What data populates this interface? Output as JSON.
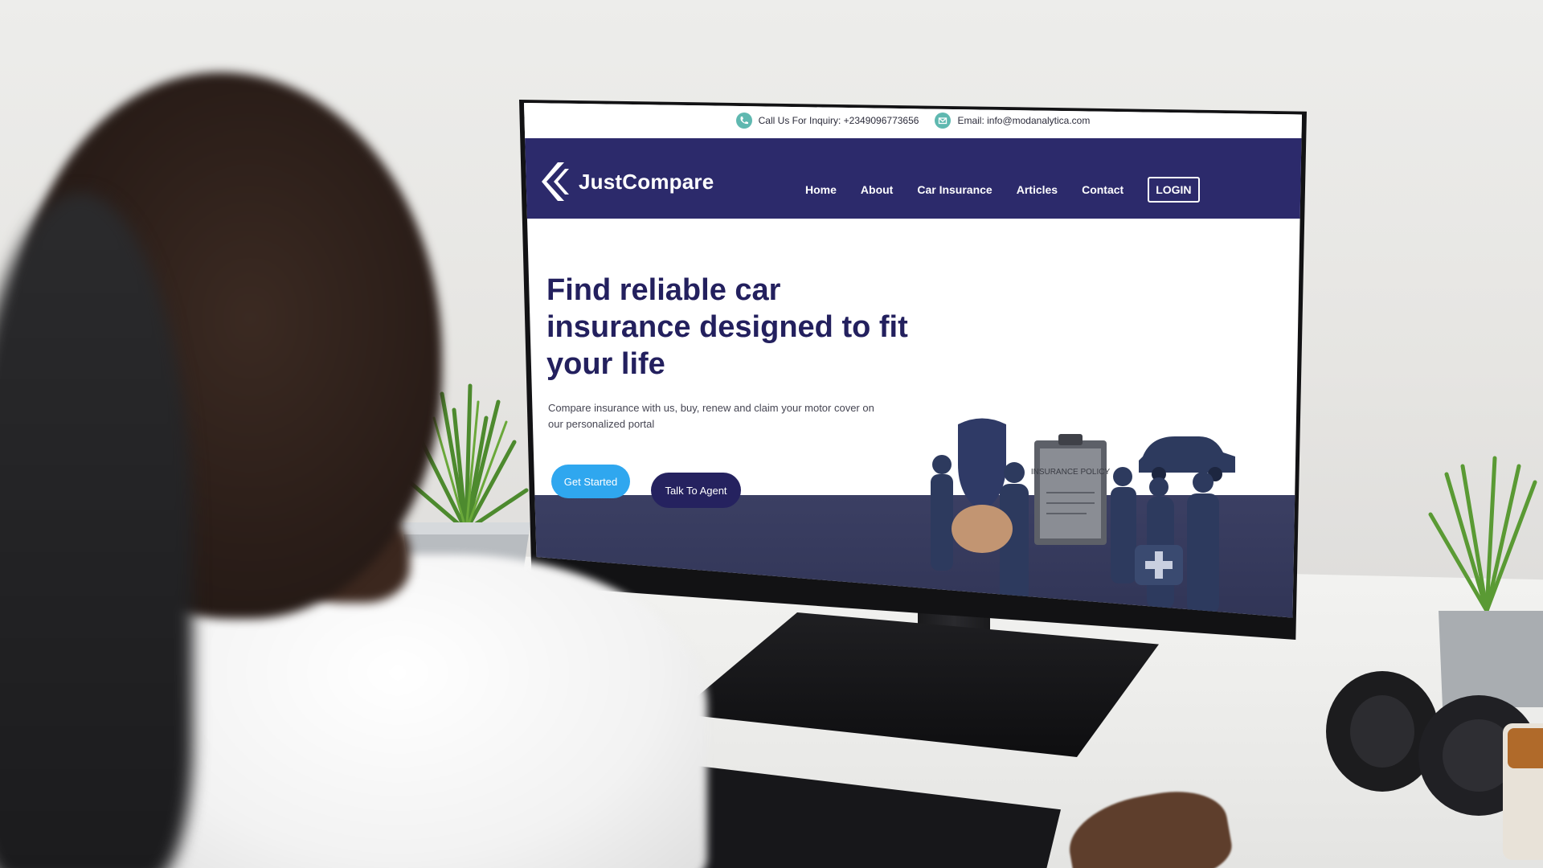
{
  "site": {
    "topbar": {
      "phone_label": "Call Us For Inquiry: +2349096773656",
      "email_label": "Email: info@modanalytica.com",
      "phone_icon": "phone-icon",
      "email_icon": "mail-icon"
    },
    "brand": {
      "name": "JustCompare",
      "logo_icon": "double-chevron-logo"
    },
    "nav": {
      "items": [
        {
          "label": "Home"
        },
        {
          "label": "About"
        },
        {
          "label": "Car Insurance"
        },
        {
          "label": "Articles"
        },
        {
          "label": "Contact"
        }
      ],
      "login_label": "LOGIN"
    },
    "hero": {
      "title": "Find reliable car insurance designed to fit your life",
      "subtitle": "Compare insurance with us, buy, renew and claim your motor cover on our personalized portal",
      "cta_primary": "Get Started",
      "cta_secondary": "Talk To Agent",
      "illustration_label": "INSURANCE POLICY"
    },
    "colors": {
      "nav_bg": "#2c2a6b",
      "heading": "#23205e",
      "primary_button": "#2fa7ef",
      "secondary_button": "#25225f",
      "contact_icon": "#5fb8b0"
    }
  }
}
